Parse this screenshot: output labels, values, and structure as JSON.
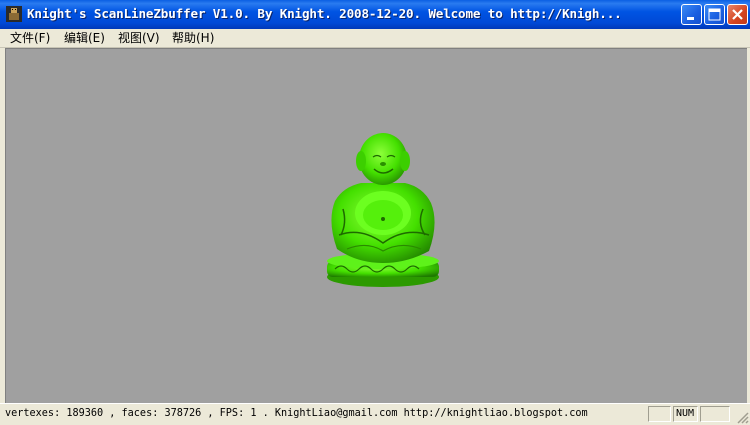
{
  "window": {
    "title": "Knight's ScanLineZbuffer V1.0. By Knight. 2008-12-20.  Welcome to http://Knigh...",
    "title_bar_color": "#0054e3"
  },
  "menu": [
    {
      "label": "文件(F)"
    },
    {
      "label": "编辑(E)"
    },
    {
      "label": "视图(V)"
    },
    {
      "label": "帮助(H)"
    }
  ],
  "viewport": {
    "background": "#a0a0a0",
    "model": {
      "name": "buddha-statue",
      "color": "#44e000"
    }
  },
  "status": {
    "text": "vertexes: 189360 , faces: 378726 , FPS: 1 .  KnightLiao@gmail.com  http://knightliao.blogspot.com",
    "num_indicator": "NUM"
  },
  "icons": [
    "app-icon",
    "minimize-icon",
    "maximize-icon",
    "close-icon",
    "resize-grip-icon"
  ]
}
